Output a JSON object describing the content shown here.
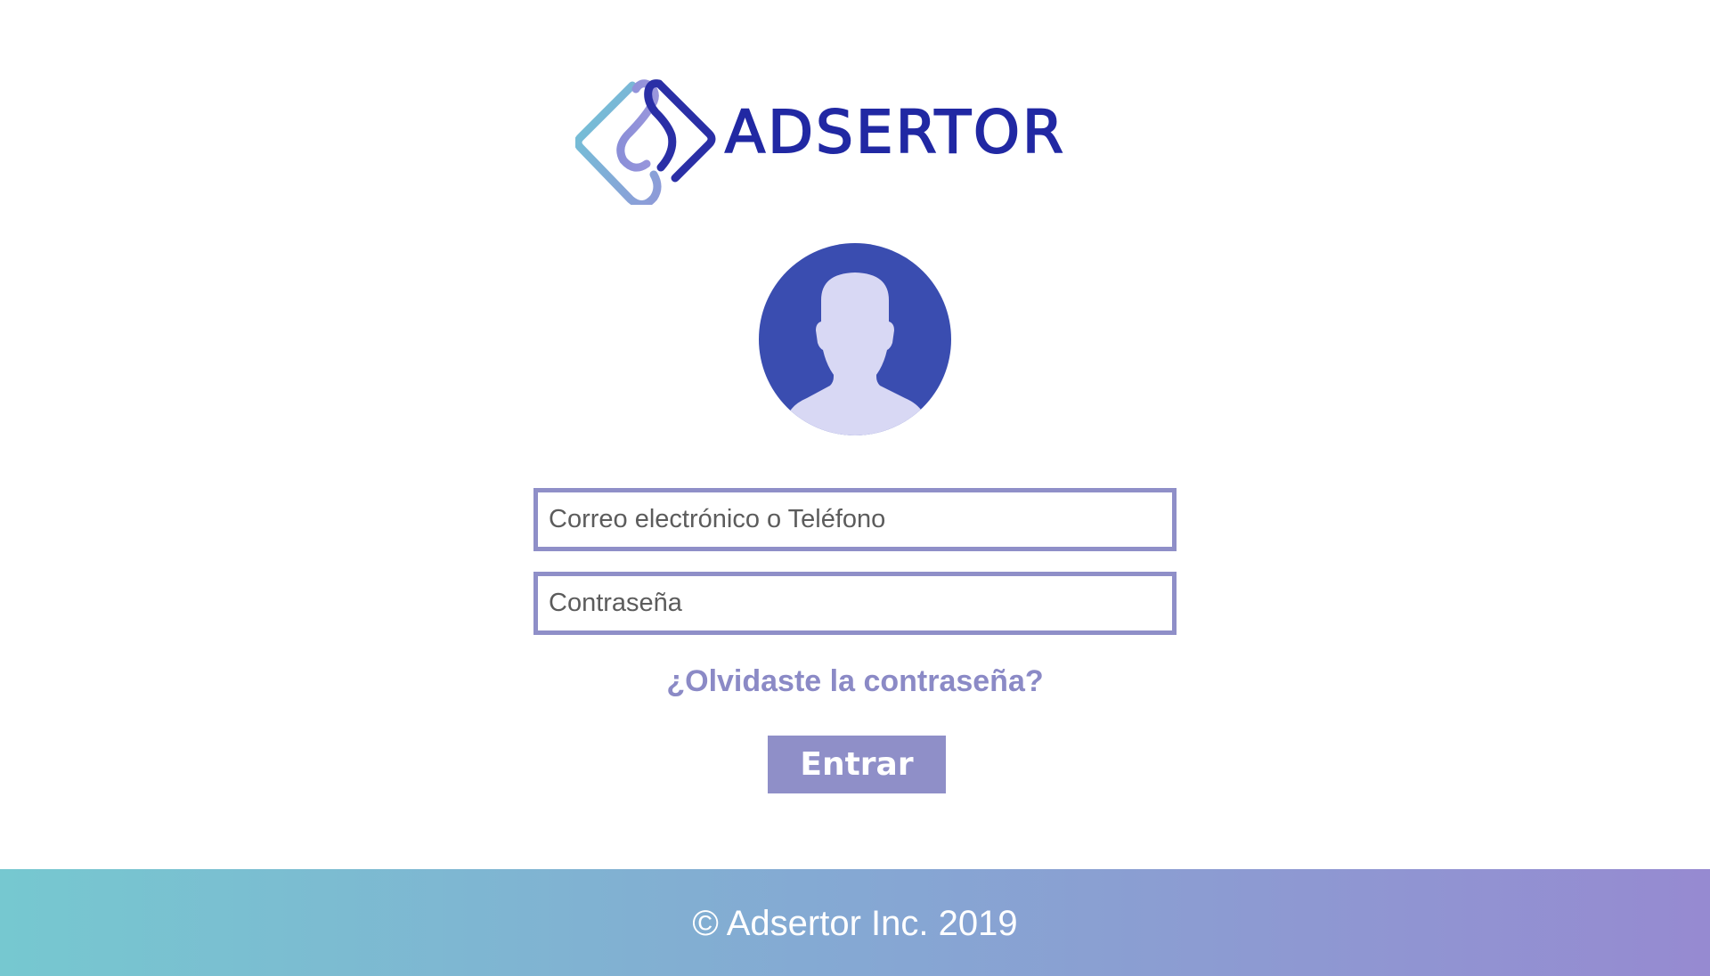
{
  "brand": {
    "name": "ADSERTOR",
    "colors": {
      "primary": "#2128a3",
      "accent": "#8f8fc8",
      "avatar_bg": "#3a4db0",
      "avatar_figure": "#d8d8f4",
      "gradient_start": "#76c8d0",
      "gradient_end": "#968ad1"
    }
  },
  "avatar": {
    "icon": "user-avatar-icon"
  },
  "login": {
    "email_placeholder": "Correo electrónico o Teléfono",
    "email_value": "",
    "password_placeholder": "Contraseña",
    "password_value": "",
    "forgot_label": "¿Olvidaste la contraseña?",
    "submit_label": "Entrar"
  },
  "footer": {
    "copyright": "© Adsertor Inc. 2019"
  }
}
